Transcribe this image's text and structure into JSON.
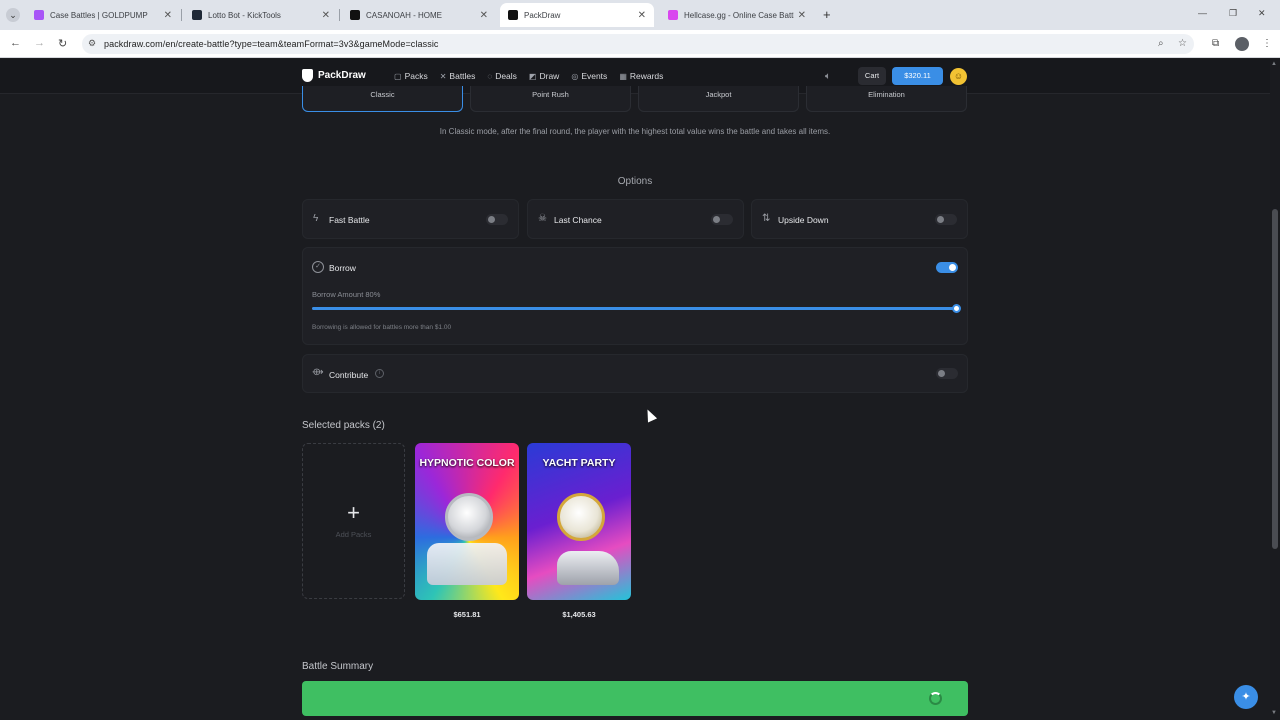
{
  "browser": {
    "tabs": [
      {
        "title": "Case Battles | GOLDPUMP",
        "color": "#a855f7"
      },
      {
        "title": "Lotto Bot - KickTools",
        "color": "#1f2937"
      },
      {
        "title": "CASANOAH - HOME",
        "color": "#111111"
      },
      {
        "title": "PackDraw",
        "color": "#111111"
      },
      {
        "title": "Hellcase.gg - Online Case Battles",
        "color": "#d946ef"
      }
    ],
    "url": "packdraw.com/en/create-battle?type=team&teamFormat=3v3&gameMode=classic"
  },
  "header": {
    "logo": "PackDraw",
    "nav": [
      "Packs",
      "Battles",
      "Deals",
      "Draw",
      "Events",
      "Rewards"
    ],
    "cart": "Cart",
    "balance": "$320.11"
  },
  "modes": {
    "items": [
      "Classic",
      "Point Rush",
      "Jackpot",
      "Elimination"
    ],
    "description": "In Classic mode, after the final round, the player with the highest total value wins the battle and takes all items."
  },
  "options": {
    "title": "Options",
    "fast_battle": "Fast Battle",
    "last_chance": "Last Chance",
    "upside_down": "Upside Down",
    "borrow": {
      "label": "Borrow",
      "amount_label": "Borrow Amount 80%",
      "percent": 100,
      "note": "Borrowing is allowed for battles more than $1.00",
      "enabled": true
    },
    "contribute": "Contribute",
    "contribute_info": "i"
  },
  "packs": {
    "title": "Selected packs (2)",
    "add_label": "Add Packs",
    "items": [
      {
        "name": "HYPNOTIC COLOR",
        "price": "$651.81"
      },
      {
        "name": "YACHT PARTY",
        "price": "$1,405.63"
      }
    ]
  },
  "summary": {
    "title": "Battle Summary"
  },
  "colors": {
    "accent": "#3a8ee6",
    "create_button": "#3fbf62",
    "background": "#1b1c20"
  }
}
